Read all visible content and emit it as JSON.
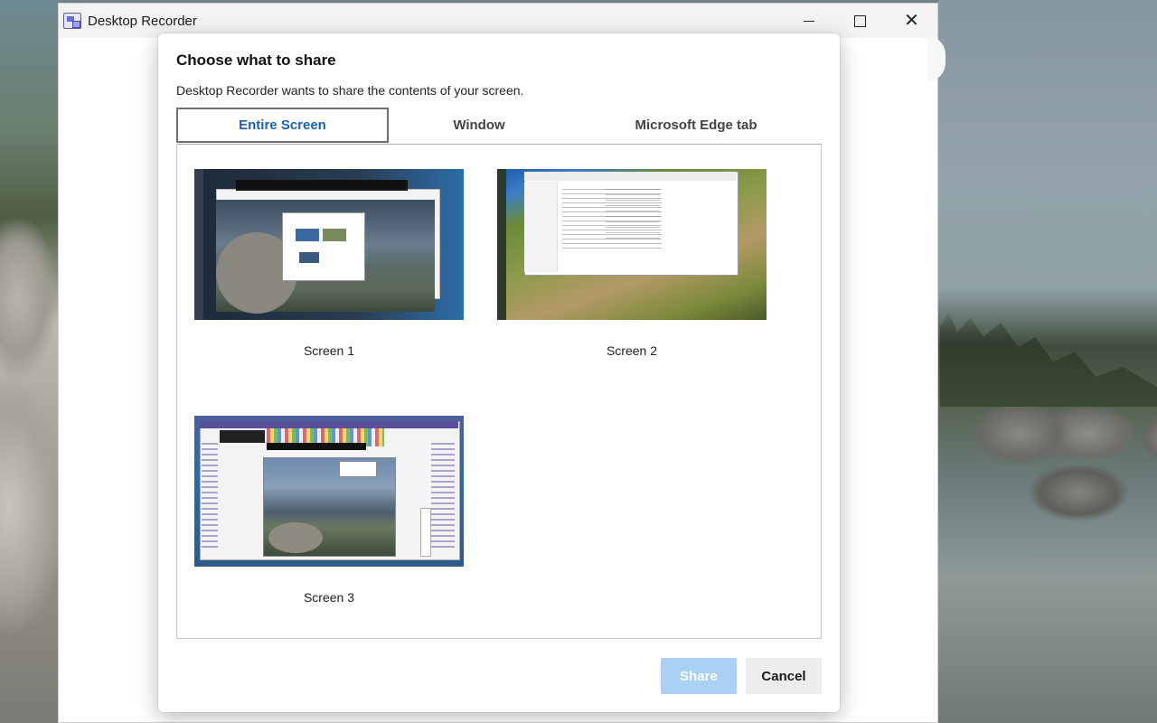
{
  "app": {
    "title": "Desktop Recorder",
    "controls": {
      "minimize": "minimize",
      "maximize": "maximize",
      "close": "✕"
    }
  },
  "dialog": {
    "title": "Choose what to share",
    "subtitle": "Desktop Recorder wants to share the contents of your screen.",
    "tabs": [
      {
        "label": "Entire Screen",
        "selected": true
      },
      {
        "label": "Window",
        "selected": false
      },
      {
        "label": "Microsoft Edge tab",
        "selected": false
      }
    ],
    "screens": [
      {
        "label": "Screen 1"
      },
      {
        "label": "Screen 2"
      },
      {
        "label": "Screen 3"
      }
    ],
    "buttons": {
      "share": "Share",
      "cancel": "Cancel"
    }
  },
  "colors": {
    "selected_tab_text": "#1a63b0",
    "share_button_disabled": "#a9d1f3",
    "cancel_button": "#ededed"
  },
  "icons": {
    "app_icon": "desktop-recorder-icon",
    "minimize": "minimize-icon",
    "maximize": "maximize-icon",
    "close": "close-icon"
  }
}
